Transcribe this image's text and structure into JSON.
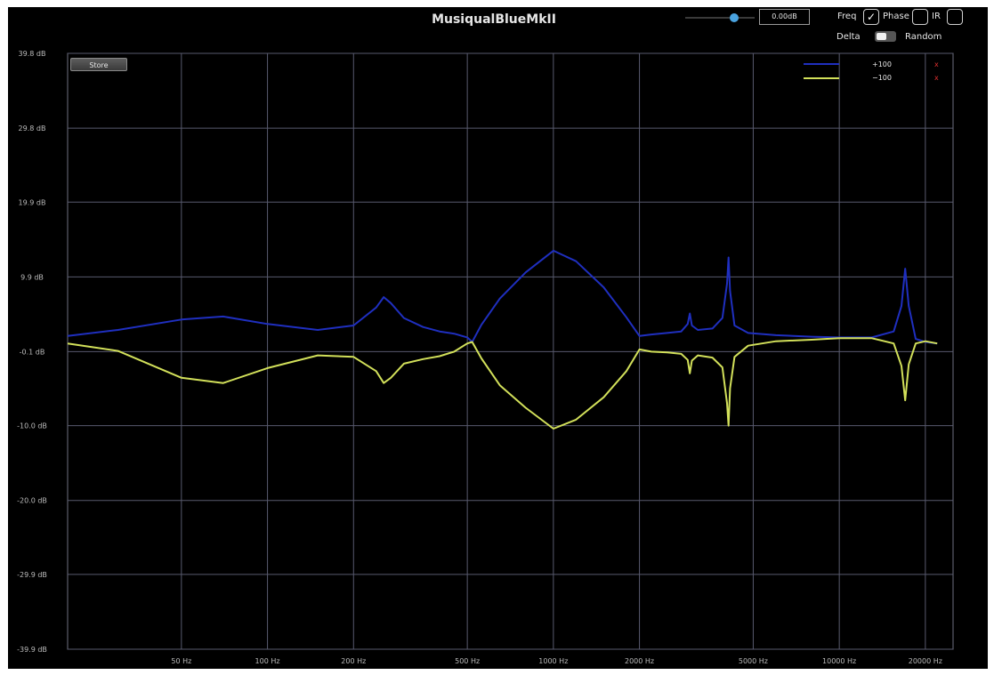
{
  "window": {
    "title": "MusiqualBlueMkII"
  },
  "controls": {
    "gain_value": "0.00dB",
    "gain_level": 0.7,
    "freq_label": "Freq",
    "freq_checked": true,
    "phase_label": "Phase",
    "phase_checked": false,
    "ir_label": "IR",
    "ir_checked": false,
    "delta_label": "Delta",
    "random_label": "Random",
    "store_label": "Store",
    "check_glyph": "✓"
  },
  "legend": [
    {
      "label": "+100",
      "color": "#1f2fbf",
      "remove": "x",
      "remove_color": "#e03030"
    },
    {
      "label": "−100",
      "color": "#d2e05a",
      "remove": "x",
      "remove_color": "#e03030"
    }
  ],
  "chart_data": {
    "type": "line",
    "y_ticks": [
      "39.8 dB",
      "29.8 dB",
      "19.9 dB",
      "9.9 dB",
      "-0.1 dB",
      "-10.0 dB",
      "-20.0 dB",
      "-29.9 dB",
      "-39.9 dB"
    ],
    "y_tick_values": [
      39.8,
      29.8,
      19.9,
      9.9,
      -0.1,
      -10.0,
      -20.0,
      -29.9,
      -39.9
    ],
    "x_ticks": [
      "50 Hz",
      "100 Hz",
      "200 Hz",
      "500 Hz",
      "1000 Hz",
      "2000 Hz",
      "5000 Hz",
      "10000 Hz",
      "20000 Hz"
    ],
    "x_tick_values": [
      50,
      100,
      200,
      500,
      1000,
      2000,
      5000,
      10000,
      20000
    ],
    "x_scale": "log",
    "xlim": [
      20,
      25000
    ],
    "ylim": [
      -39.9,
      39.8
    ],
    "grid": true,
    "legend_position": "top-right",
    "series": [
      {
        "name": "+100",
        "color": "#1f2fbf",
        "x": [
          20,
          30,
          50,
          70,
          100,
          150,
          200,
          240,
          255,
          270,
          300,
          350,
          400,
          450,
          500,
          520,
          560,
          650,
          800,
          1000,
          1200,
          1500,
          1800,
          2000,
          2200,
          2500,
          2800,
          2950,
          3000,
          3050,
          3200,
          3600,
          3900,
          4050,
          4100,
          4150,
          4300,
          4800,
          6000,
          8000,
          10000,
          13000,
          15500,
          16500,
          17000,
          17500,
          18500,
          20000,
          22000
        ],
        "y": [
          2.0,
          2.8,
          4.2,
          4.6,
          3.6,
          2.8,
          3.4,
          5.8,
          7.2,
          6.4,
          4.4,
          3.2,
          2.6,
          2.3,
          1.8,
          1.2,
          3.5,
          7.0,
          10.5,
          13.4,
          12.0,
          8.5,
          4.5,
          2.0,
          2.2,
          2.4,
          2.6,
          3.6,
          5.0,
          3.4,
          2.8,
          3.0,
          4.4,
          9.0,
          12.5,
          8.0,
          3.4,
          2.4,
          2.1,
          1.9,
          1.8,
          1.8,
          2.6,
          6.0,
          11.0,
          6.0,
          1.6,
          1.2,
          1.0
        ]
      },
      {
        "name": "−100",
        "color": "#d2e05a",
        "x": [
          20,
          30,
          50,
          70,
          100,
          150,
          200,
          240,
          255,
          270,
          300,
          350,
          400,
          450,
          500,
          520,
          560,
          650,
          800,
          1000,
          1200,
          1500,
          1800,
          2000,
          2200,
          2500,
          2800,
          2950,
          3000,
          3050,
          3200,
          3600,
          3900,
          4050,
          4100,
          4150,
          4300,
          4800,
          6000,
          8000,
          10000,
          13000,
          15500,
          16500,
          17000,
          17500,
          18500,
          20000,
          22000
        ],
        "y": [
          1.0,
          0.0,
          -3.6,
          -4.3,
          -2.3,
          -0.6,
          -0.8,
          -2.7,
          -4.3,
          -3.6,
          -1.7,
          -1.1,
          -0.7,
          -0.1,
          1.0,
          1.2,
          -1.0,
          -4.6,
          -7.6,
          -10.4,
          -9.2,
          -6.2,
          -2.7,
          0.2,
          -0.1,
          -0.2,
          -0.4,
          -1.2,
          -3.0,
          -1.3,
          -0.6,
          -0.9,
          -2.2,
          -7.0,
          -10.0,
          -5.0,
          -0.8,
          0.7,
          1.3,
          1.5,
          1.7,
          1.7,
          1.0,
          -2.0,
          -6.6,
          -1.8,
          1.0,
          1.3,
          1.0
        ]
      }
    ]
  }
}
